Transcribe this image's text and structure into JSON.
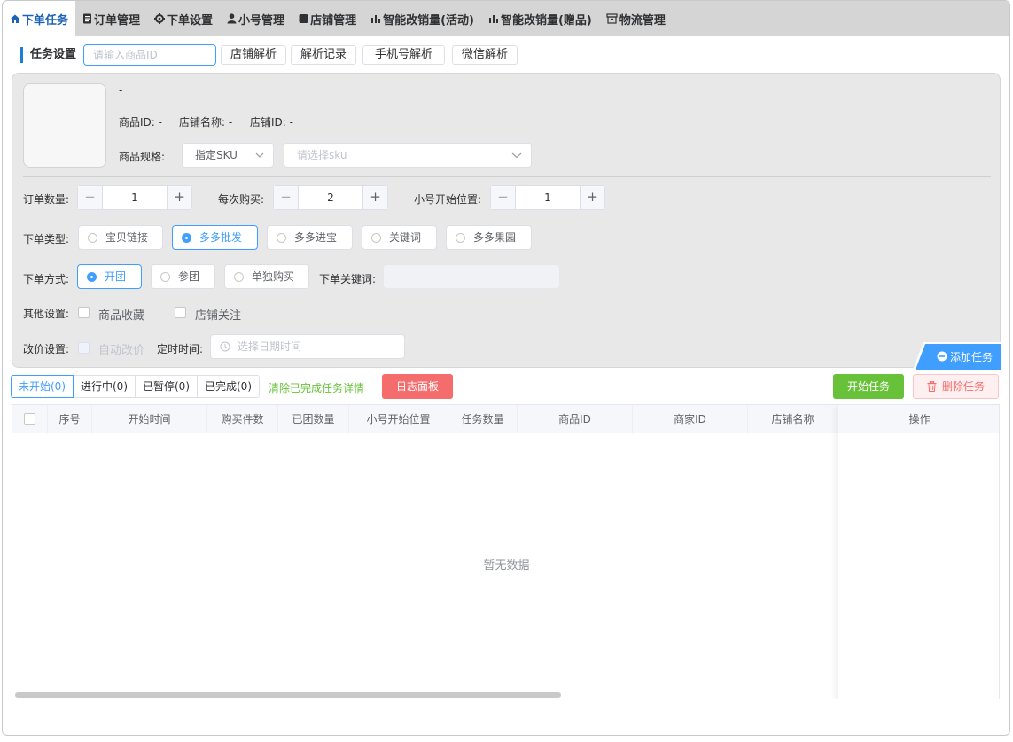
{
  "tabs": [
    {
      "label": "下单任务",
      "icon": "home-icon"
    },
    {
      "label": "订单管理",
      "icon": "document-icon"
    },
    {
      "label": "下单设置",
      "icon": "gear-icon"
    },
    {
      "label": "小号管理",
      "icon": "user-icon"
    },
    {
      "label": "店铺管理",
      "icon": "store-icon"
    },
    {
      "label": "智能改销量(活动)",
      "icon": "bar-chart-icon"
    },
    {
      "label": "智能改销量(赠品)",
      "icon": "bar-chart-icon"
    },
    {
      "label": "物流管理",
      "icon": "box-icon"
    }
  ],
  "task_settings": {
    "title": "任务设置",
    "product_id_placeholder": "请输入商品ID",
    "buttons": [
      "店铺解析",
      "解析记录",
      "手机号解析",
      "微信解析"
    ]
  },
  "product": {
    "name": "-",
    "product_id_label": "商品ID: -",
    "store_name_label": "店铺名称: -",
    "store_id_label": "店铺ID: -",
    "spec_label": "商品规格:",
    "spec_select": "指定SKU",
    "sku_placeholder": "请选择sku"
  },
  "quantities": {
    "order_qty_label": "订单数量:",
    "order_qty": "1",
    "per_buy_label": "每次购买:",
    "per_buy": "2",
    "start_pos_label": "小号开始位置:",
    "start_pos": "1"
  },
  "order_type": {
    "label": "下单类型:",
    "options": [
      "宝贝链接",
      "多多批发",
      "多多进宝",
      "关键词",
      "多多果园"
    ],
    "selected": 1
  },
  "order_method": {
    "label": "下单方式:",
    "options": [
      "开团",
      "参团",
      "单独购买"
    ],
    "selected": 0,
    "keyword_label": "下单关键词:"
  },
  "other": {
    "label": "其他设置:",
    "fav_label": "商品收藏",
    "follow_label": "店铺关注"
  },
  "price": {
    "label": "改价设置:",
    "auto_label": "自动改价",
    "timer_label": "定时时间:",
    "date_placeholder": "选择日期时间"
  },
  "add_task_label": "添加任务",
  "status_tabs": [
    "未开始(0)",
    "进行中(0)",
    "已暂停(0)",
    "已完成(0)"
  ],
  "clear_link": "清除已完成任务详情",
  "log_button": "日志面板",
  "start_button": "开始任务",
  "delete_button": "删除任务",
  "columns": [
    "序号",
    "开始时间",
    "购买件数",
    "已团数量",
    "小号开始位置",
    "任务数量",
    "商品ID",
    "商家ID",
    "店铺名称",
    "操作"
  ],
  "empty_text": "暂无数据",
  "colors": {
    "accent": "#409eff",
    "danger": "#f56c6c",
    "success": "#67c23a"
  }
}
